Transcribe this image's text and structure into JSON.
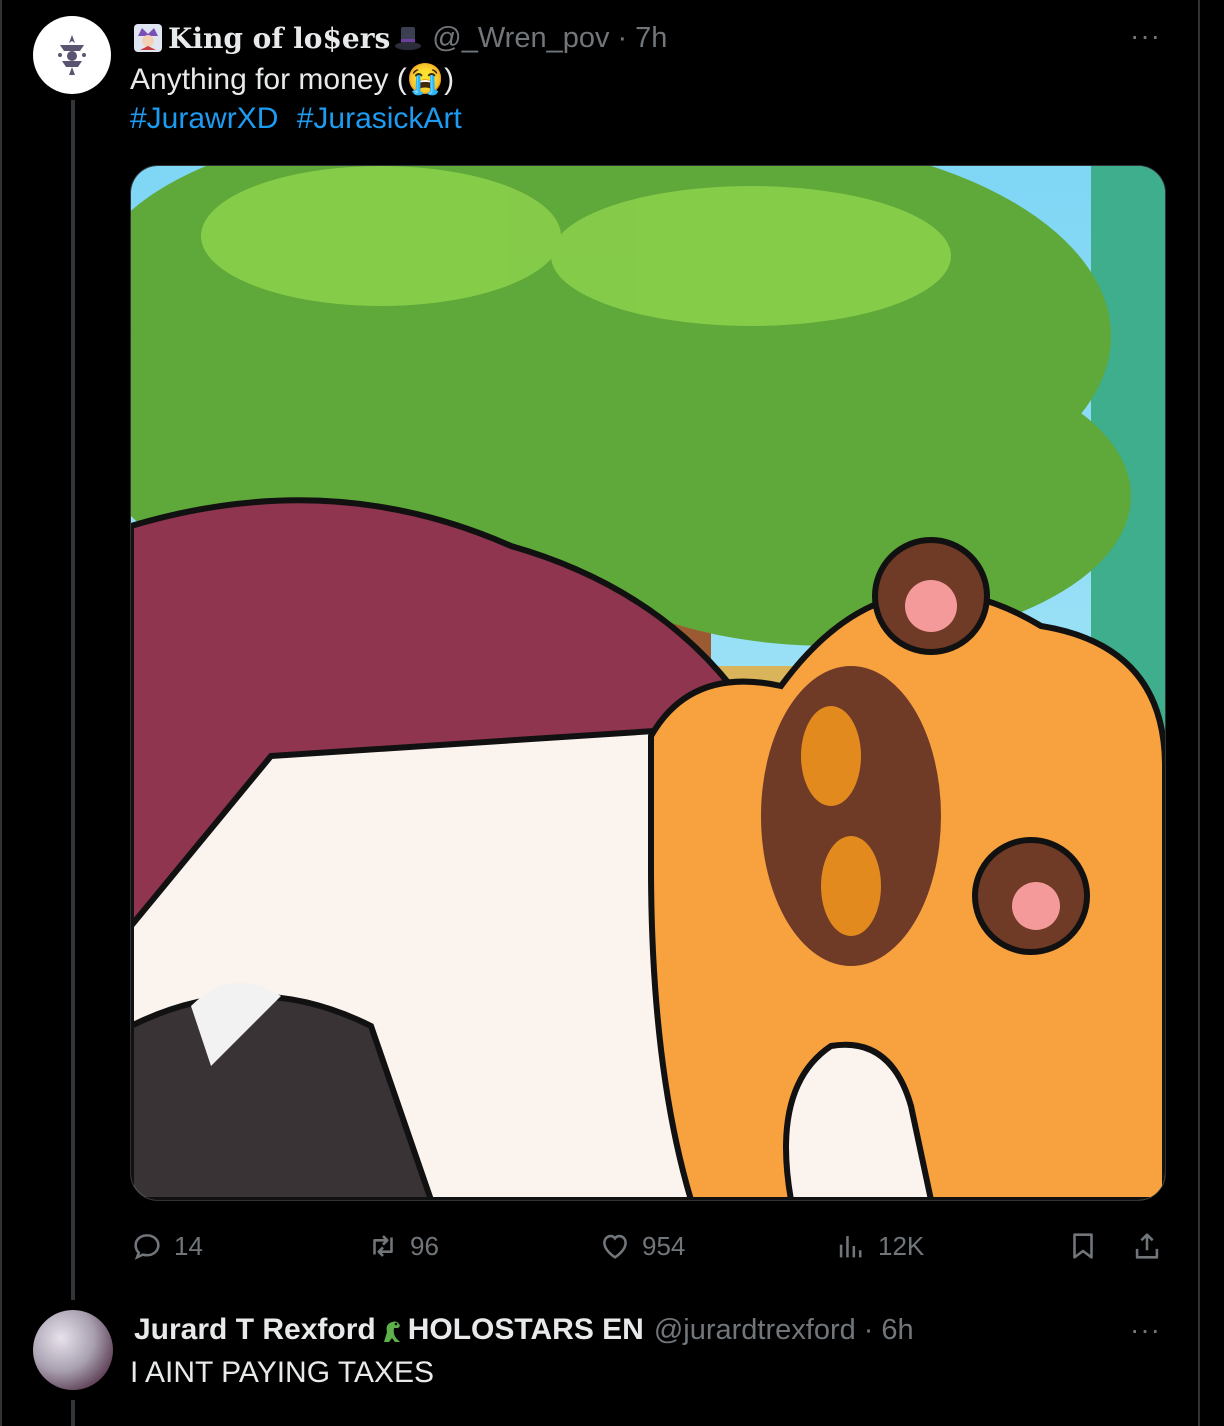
{
  "tweet1": {
    "display_name": "King of lo$ers",
    "handle": "@_Wren_pov",
    "separator": "·",
    "time": "7h",
    "text": "Anything for money (😭)",
    "hashtags": [
      "#JurawrXD",
      "#JurasickArt"
    ],
    "media_icon": "animal-crossing-fanart-image",
    "stats": {
      "replies": "14",
      "reposts": "96",
      "likes": "954",
      "views": "12K"
    },
    "more_label": "···"
  },
  "tweet2": {
    "display_name": "Jurard T Rexford",
    "affiliation": "HOLOSTARS EN",
    "handle": "@jurardtrexford",
    "separator": "·",
    "time": "6h",
    "text": "I AINT PAYING TAXES",
    "more_label": "···"
  },
  "colors": {
    "background": "#000000",
    "text": "#e7e9ea",
    "secondary": "#71767b",
    "link": "#1d9bf0",
    "border": "#2f3336"
  },
  "icons": [
    "reply-icon",
    "repost-icon",
    "like-icon",
    "views-icon",
    "bookmark-icon",
    "share-icon",
    "more-icon",
    "jester-emoji-icon",
    "top-hat-emoji-icon",
    "dinosaur-emoji-icon"
  ]
}
